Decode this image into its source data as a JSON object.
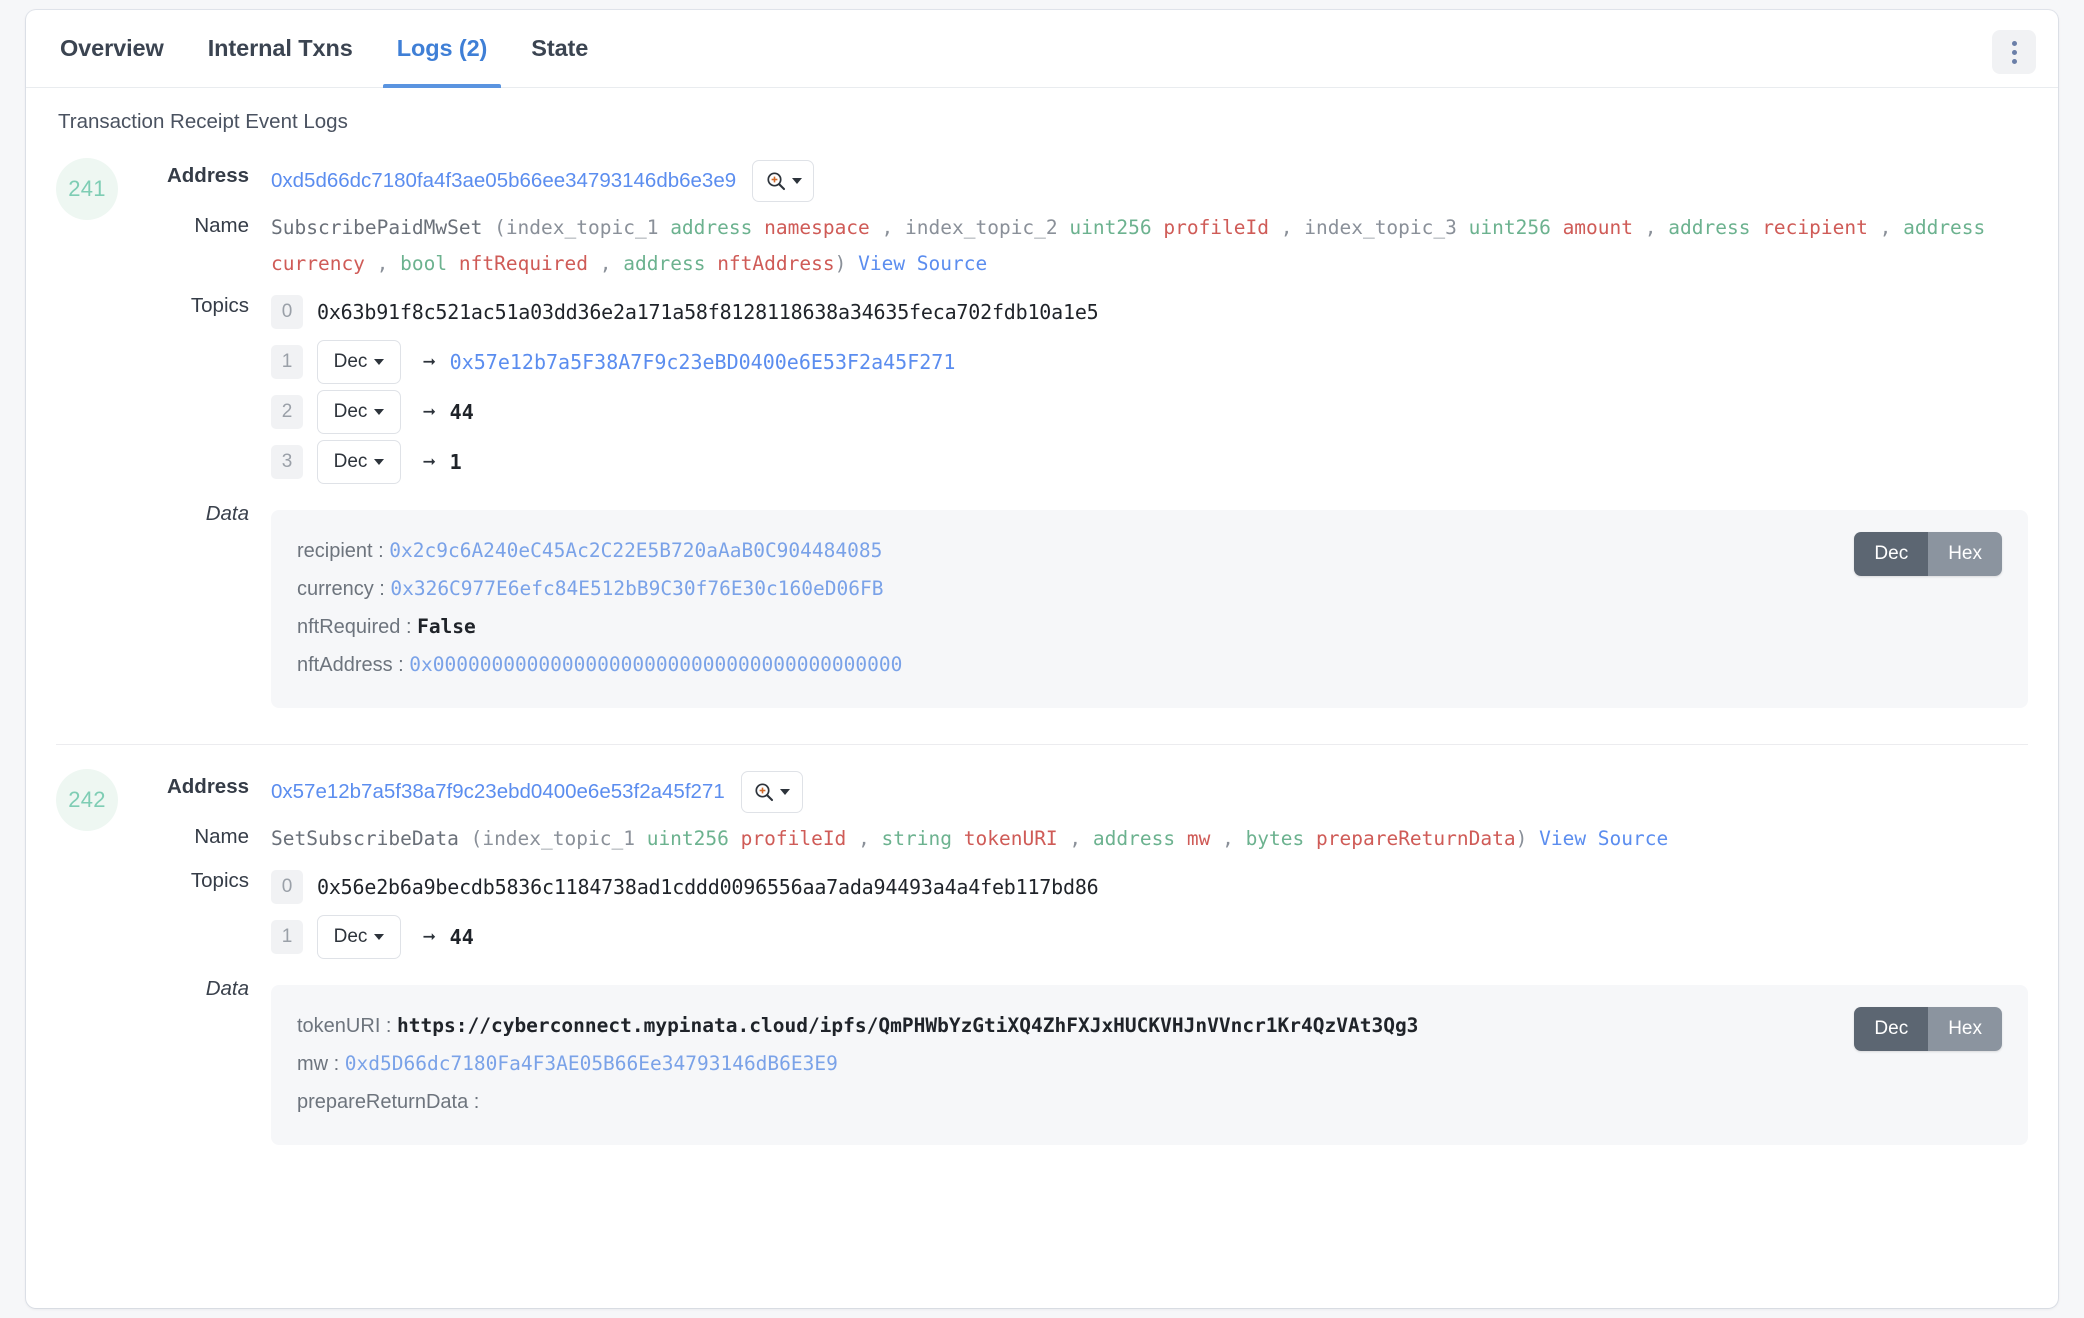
{
  "tabs": [
    {
      "label": "Overview",
      "active": false
    },
    {
      "label": "Internal Txns",
      "active": false
    },
    {
      "label": "Logs (2)",
      "active": true
    },
    {
      "label": "State",
      "active": false
    }
  ],
  "section_title": "Transaction Receipt Event Logs",
  "labels": {
    "address": "Address",
    "name": "Name",
    "topics": "Topics",
    "data": "Data",
    "view_source": "View Source",
    "dec": "Dec",
    "hex": "Hex"
  },
  "colors": {
    "accent": "#5b8def",
    "badge_bg": "#eef7f2",
    "badge_text": "#7ecdb4",
    "type": "#6cb28f",
    "param": "#cf5b57",
    "panel_bg": "#f6f7f9",
    "toggle_on": "#5c6672",
    "toggle_off": "#8b949f"
  },
  "logs": [
    {
      "index": "241",
      "address": "0xd5d66dc7180fa4f3ae05b66ee34793146db6e3e9",
      "name_signature": {
        "function": "SubscribePaidMwSet",
        "open_paren": " (",
        "tokens": [
          {
            "text": "index_topic_1",
            "kind": "idx"
          },
          {
            "text": "address",
            "kind": "type"
          },
          {
            "text": "namespace",
            "kind": "param"
          },
          {
            "text": ", ",
            "kind": "punc"
          },
          {
            "text": "index_topic_2",
            "kind": "idx"
          },
          {
            "text": "uint256",
            "kind": "type"
          },
          {
            "text": "profileId",
            "kind": "param"
          },
          {
            "text": ", ",
            "kind": "punc"
          },
          {
            "text": "index_topic_3",
            "kind": "idx"
          },
          {
            "text": "uint256",
            "kind": "type"
          },
          {
            "text": "amount",
            "kind": "param"
          },
          {
            "text": ", ",
            "kind": "punc"
          },
          {
            "text": "address",
            "kind": "type"
          },
          {
            "text": "recipient",
            "kind": "param"
          },
          {
            "text": ", ",
            "kind": "punc"
          },
          {
            "text": "address",
            "kind": "type"
          },
          {
            "text": "currency",
            "kind": "param"
          },
          {
            "text": ", ",
            "kind": "punc"
          },
          {
            "text": "bool",
            "kind": "type"
          },
          {
            "text": "nftRequired",
            "kind": "param"
          },
          {
            "text": ", ",
            "kind": "punc"
          },
          {
            "text": "address",
            "kind": "type"
          },
          {
            "text": "nftAddress",
            "kind": "param"
          }
        ],
        "close_paren": ")"
      },
      "topics": [
        {
          "num": "0",
          "type": "hash",
          "value": "0x63b91f8c521ac51a03dd36e2a171a58f8128118638a34635feca702fdb10a1e5"
        },
        {
          "num": "1",
          "type": "decoded",
          "format": "Dec",
          "value": "0x57e12b7a5F38A7F9c23eBD0400e6E53F2a45F271",
          "link": true
        },
        {
          "num": "2",
          "type": "decoded",
          "format": "Dec",
          "value": "44",
          "link": false
        },
        {
          "num": "3",
          "type": "decoded",
          "format": "Dec",
          "value": "1",
          "link": false
        }
      ],
      "data_rows": [
        {
          "key": "recipient",
          "value": "0x2c9c6A240eC45Ac2C22E5B720aAaB0C904484085",
          "style": "link"
        },
        {
          "key": "currency",
          "value": "0x326C977E6efc84E512bB9C30f76E30c160eD06FB",
          "style": "link"
        },
        {
          "key": "nftRequired",
          "value": "False",
          "style": "mono"
        },
        {
          "key": "nftAddress",
          "value": "0x0000000000000000000000000000000000000000",
          "style": "link"
        }
      ],
      "data_toggle": {
        "selected": "Dec"
      }
    },
    {
      "index": "242",
      "address": "0x57e12b7a5f38a7f9c23ebd0400e6e53f2a45f271",
      "name_signature": {
        "function": "SetSubscribeData",
        "open_paren": " (",
        "tokens": [
          {
            "text": "index_topic_1",
            "kind": "idx"
          },
          {
            "text": "uint256",
            "kind": "type"
          },
          {
            "text": "profileId",
            "kind": "param"
          },
          {
            "text": ", ",
            "kind": "punc"
          },
          {
            "text": "string",
            "kind": "type"
          },
          {
            "text": "tokenURI",
            "kind": "param"
          },
          {
            "text": ", ",
            "kind": "punc"
          },
          {
            "text": "address",
            "kind": "type"
          },
          {
            "text": "mw",
            "kind": "param"
          },
          {
            "text": ", ",
            "kind": "punc"
          },
          {
            "text": "bytes",
            "kind": "type"
          },
          {
            "text": "prepareReturnData",
            "kind": "param"
          }
        ],
        "close_paren": ")"
      },
      "topics": [
        {
          "num": "0",
          "type": "hash",
          "value": "0x56e2b6a9becdb5836c1184738ad1cddd0096556aa7ada94493a4a4feb117bd86"
        },
        {
          "num": "1",
          "type": "decoded",
          "format": "Dec",
          "value": "44",
          "link": false
        }
      ],
      "data_rows": [
        {
          "key": "tokenURI",
          "value": "https://cyberconnect.mypinata.cloud/ipfs/QmPHWbYzGtiXQ4ZhFXJxHUCKVHJnVVncr1Kr4QzVAt3Qg3",
          "style": "mono"
        },
        {
          "key": "mw",
          "value": "0xd5D66dc7180Fa4F3AE05B66Ee34793146dB6E3E9",
          "style": "link"
        },
        {
          "key": "prepareReturnData",
          "value": "",
          "style": "mono"
        }
      ],
      "data_toggle": {
        "selected": "Dec"
      }
    }
  ]
}
